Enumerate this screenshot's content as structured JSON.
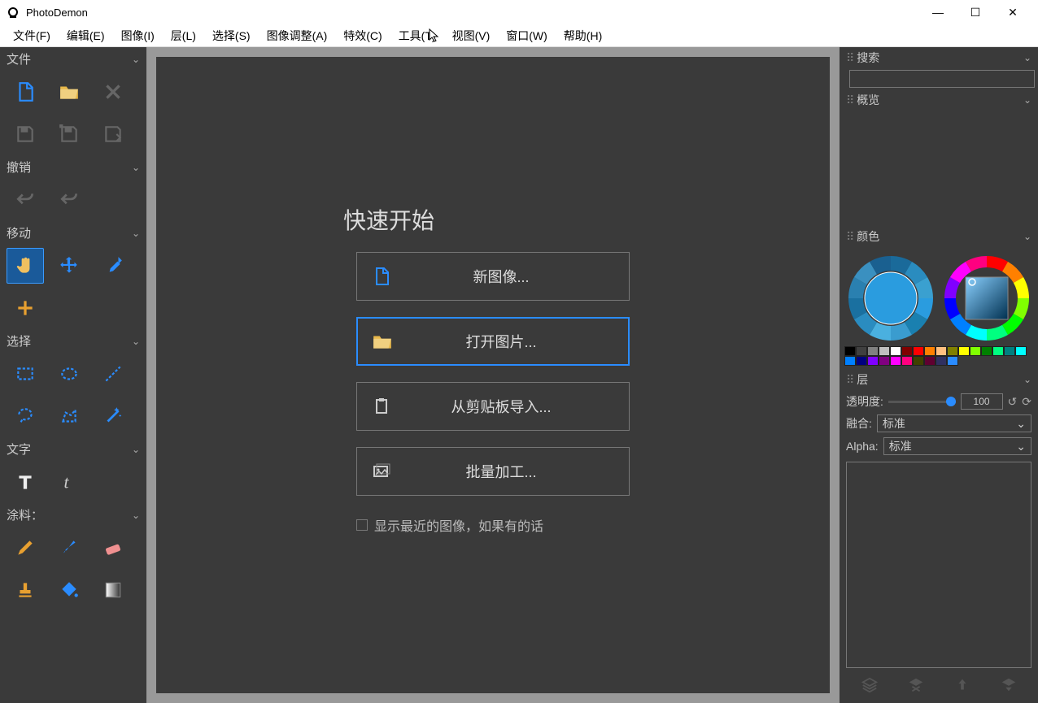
{
  "app": {
    "title": "PhotoDemon"
  },
  "menu": {
    "file": "文件(F)",
    "edit": "编辑(E)",
    "image": "图像(I)",
    "layer": "层(L)",
    "select": "选择(S)",
    "adjust": "图像调整(A)",
    "effects": "特效(C)",
    "tools": "工具(T)",
    "view": "视图(V)",
    "window": "窗口(W)",
    "help": "帮助(H)"
  },
  "toolbox": {
    "file": "文件",
    "undo": "撤销",
    "move": "移动",
    "select": "选择",
    "text": "文字",
    "paint": "涂料："
  },
  "quickstart": {
    "title": "快速开始",
    "new_image": "新图像...",
    "open_image": "打开图片...",
    "from_clipboard": "从剪贴板导入...",
    "batch": "批量加工...",
    "show_recent": "显示最近的图像，如果有的话"
  },
  "right": {
    "search": "搜索",
    "preview": "概览",
    "color": "颜色",
    "layer": "层",
    "opacity_label": "透明度:",
    "opacity_value": "100",
    "blend_label": "融合:",
    "blend_value": "标准",
    "alpha_label": "Alpha:",
    "alpha_value": "标准"
  },
  "colors": {
    "swatches": [
      "#000000",
      "#404040",
      "#808080",
      "#c0c0c0",
      "#ffffff",
      "#800000",
      "#ff0000",
      "#ff8000",
      "#ffc080",
      "#808000",
      "#ffff00",
      "#80ff00",
      "#008000",
      "#00ff80",
      "#008080",
      "#00ffff",
      "#0080ff",
      "#000080",
      "#8000ff",
      "#800080",
      "#ff00ff",
      "#ff0080",
      "#404000",
      "#600030",
      "#303060",
      "#2a8cff"
    ]
  }
}
